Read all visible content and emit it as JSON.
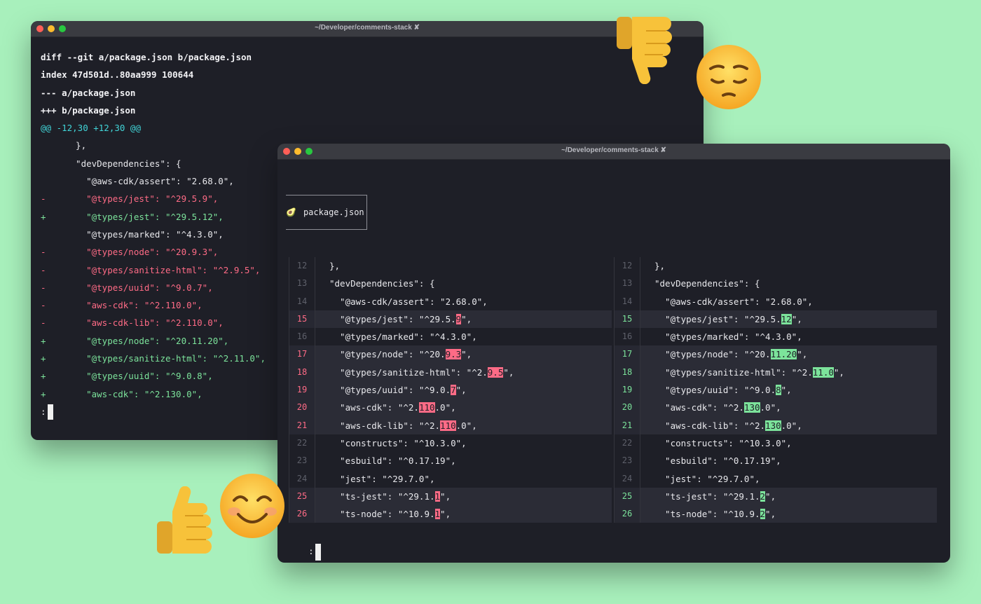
{
  "window_back": {
    "title": "~/Developer/comments-stack ✘",
    "lines": [
      {
        "type": "bold",
        "sign": "",
        "text": "diff --git a/package.json b/package.json"
      },
      {
        "type": "bold",
        "sign": "",
        "text": "index 47d501d..80aa999 100644"
      },
      {
        "type": "bold",
        "sign": "",
        "text": "--- a/package.json"
      },
      {
        "type": "bold",
        "sign": "",
        "text": "+++ b/package.json"
      },
      {
        "type": "hunk",
        "sign": "",
        "text": "@@ -12,30 +12,30 @@"
      },
      {
        "type": "ctx",
        "sign": " ",
        "text": "  },"
      },
      {
        "type": "ctx",
        "sign": " ",
        "text": "  \"devDependencies\": {"
      },
      {
        "type": "ctx",
        "sign": " ",
        "text": "    \"@aws-cdk/assert\": \"2.68.0\","
      },
      {
        "type": "del",
        "sign": "-",
        "text": "    \"@types/jest\": \"^29.5.9\","
      },
      {
        "type": "add",
        "sign": "+",
        "text": "    \"@types/jest\": \"^29.5.12\","
      },
      {
        "type": "ctx",
        "sign": " ",
        "text": "    \"@types/marked\": \"^4.3.0\","
      },
      {
        "type": "del",
        "sign": "-",
        "text": "    \"@types/node\": \"^20.9.3\","
      },
      {
        "type": "del",
        "sign": "-",
        "text": "    \"@types/sanitize-html\": \"^2.9.5\","
      },
      {
        "type": "del",
        "sign": "-",
        "text": "    \"@types/uuid\": \"^9.0.7\","
      },
      {
        "type": "del",
        "sign": "-",
        "text": "    \"aws-cdk\": \"^2.110.0\","
      },
      {
        "type": "del",
        "sign": "-",
        "text": "    \"aws-cdk-lib\": \"^2.110.0\","
      },
      {
        "type": "add",
        "sign": "+",
        "text": "    \"@types/node\": \"^20.11.20\","
      },
      {
        "type": "add",
        "sign": "+",
        "text": "    \"@types/sanitize-html\": \"^2.11.0\","
      },
      {
        "type": "add",
        "sign": "+",
        "text": "    \"@types/uuid\": \"^9.0.8\","
      },
      {
        "type": "add",
        "sign": "+",
        "text": "    \"aws-cdk\": \"^2.130.0\","
      }
    ],
    "prompt": ":"
  },
  "window_front": {
    "title": "~/Developer/comments-stack ✘",
    "file_name": "package.json",
    "prompt": ":",
    "left_rows": [
      {
        "ln": "12",
        "chg": false,
        "parts": [
          {
            "t": "},"
          }
        ]
      },
      {
        "ln": "13",
        "chg": false,
        "parts": [
          {
            "t": "\"devDependencies\": {"
          }
        ]
      },
      {
        "ln": "14",
        "chg": false,
        "parts": [
          {
            "t": "  \"@aws-cdk/assert\": \"2.68.0\","
          }
        ]
      },
      {
        "ln": "15",
        "chg": true,
        "parts": [
          {
            "t": "  \"@types/jest\": \"^29.5."
          },
          {
            "t": "9",
            "h": true
          },
          {
            "t": "\","
          }
        ]
      },
      {
        "ln": "16",
        "chg": false,
        "parts": [
          {
            "t": "  \"@types/marked\": \"^4.3.0\","
          }
        ]
      },
      {
        "ln": "17",
        "chg": true,
        "parts": [
          {
            "t": "  \"@types/node\": \"^20."
          },
          {
            "t": "9.3",
            "h": true
          },
          {
            "t": "\","
          }
        ]
      },
      {
        "ln": "18",
        "chg": true,
        "parts": [
          {
            "t": "  \"@types/sanitize-html\": \"^2."
          },
          {
            "t": "9.5",
            "h": true
          },
          {
            "t": "\","
          }
        ]
      },
      {
        "ln": "19",
        "chg": true,
        "parts": [
          {
            "t": "  \"@types/uuid\": \"^9.0."
          },
          {
            "t": "7",
            "h": true
          },
          {
            "t": "\","
          }
        ]
      },
      {
        "ln": "20",
        "chg": true,
        "parts": [
          {
            "t": "  \"aws-cdk\": \"^2."
          },
          {
            "t": "110",
            "h": true
          },
          {
            "t": ".0\","
          }
        ]
      },
      {
        "ln": "21",
        "chg": true,
        "parts": [
          {
            "t": "  \"aws-cdk-lib\": \"^2."
          },
          {
            "t": "110",
            "h": true
          },
          {
            "t": ".0\","
          }
        ]
      },
      {
        "ln": "22",
        "chg": false,
        "parts": [
          {
            "t": "  \"constructs\": \"^10.3.0\","
          }
        ]
      },
      {
        "ln": "23",
        "chg": false,
        "parts": [
          {
            "t": "  \"esbuild\": \"^0.17.19\","
          }
        ]
      },
      {
        "ln": "24",
        "chg": false,
        "parts": [
          {
            "t": "  \"jest\": \"^29.7.0\","
          }
        ]
      },
      {
        "ln": "25",
        "chg": true,
        "parts": [
          {
            "t": "  \"ts-jest\": \"^29.1."
          },
          {
            "t": "1",
            "h": true
          },
          {
            "t": "\","
          }
        ]
      },
      {
        "ln": "26",
        "chg": true,
        "parts": [
          {
            "t": "  \"ts-node\": \"^10.9."
          },
          {
            "t": "1",
            "h": true
          },
          {
            "t": "\","
          }
        ]
      }
    ],
    "right_rows": [
      {
        "ln": "12",
        "chg": false,
        "parts": [
          {
            "t": "},"
          }
        ]
      },
      {
        "ln": "13",
        "chg": false,
        "parts": [
          {
            "t": "\"devDependencies\": {"
          }
        ]
      },
      {
        "ln": "14",
        "chg": false,
        "parts": [
          {
            "t": "  \"@aws-cdk/assert\": \"2.68.0\","
          }
        ]
      },
      {
        "ln": "15",
        "chg": true,
        "parts": [
          {
            "t": "  \"@types/jest\": \"^29.5."
          },
          {
            "t": "12",
            "h": true
          },
          {
            "t": "\","
          }
        ]
      },
      {
        "ln": "16",
        "chg": false,
        "parts": [
          {
            "t": "  \"@types/marked\": \"^4.3.0\","
          }
        ]
      },
      {
        "ln": "17",
        "chg": true,
        "parts": [
          {
            "t": "  \"@types/node\": \"^20."
          },
          {
            "t": "11.20",
            "h": true
          },
          {
            "t": "\","
          }
        ]
      },
      {
        "ln": "18",
        "chg": true,
        "parts": [
          {
            "t": "  \"@types/sanitize-html\": \"^2."
          },
          {
            "t": "11.0",
            "h": true
          },
          {
            "t": "\","
          }
        ]
      },
      {
        "ln": "19",
        "chg": true,
        "parts": [
          {
            "t": "  \"@types/uuid\": \"^9.0."
          },
          {
            "t": "8",
            "h": true
          },
          {
            "t": "\","
          }
        ]
      },
      {
        "ln": "20",
        "chg": true,
        "parts": [
          {
            "t": "  \"aws-cdk\": \"^2."
          },
          {
            "t": "130",
            "h": true
          },
          {
            "t": ".0\","
          }
        ]
      },
      {
        "ln": "21",
        "chg": true,
        "parts": [
          {
            "t": "  \"aws-cdk-lib\": \"^2."
          },
          {
            "t": "130",
            "h": true
          },
          {
            "t": ".0\","
          }
        ]
      },
      {
        "ln": "22",
        "chg": false,
        "parts": [
          {
            "t": "  \"constructs\": \"^10.3.0\","
          }
        ]
      },
      {
        "ln": "23",
        "chg": false,
        "parts": [
          {
            "t": "  \"esbuild\": \"^0.17.19\","
          }
        ]
      },
      {
        "ln": "24",
        "chg": false,
        "parts": [
          {
            "t": "  \"jest\": \"^29.7.0\","
          }
        ]
      },
      {
        "ln": "25",
        "chg": true,
        "parts": [
          {
            "t": "  \"ts-jest\": \"^29.1."
          },
          {
            "t": "2",
            "h": true
          },
          {
            "t": "\","
          }
        ]
      },
      {
        "ln": "26",
        "chg": true,
        "parts": [
          {
            "t": "  \"ts-node\": \"^10.9."
          },
          {
            "t": "2",
            "h": true
          },
          {
            "t": "\","
          }
        ]
      }
    ]
  },
  "decorations": {
    "thumbs_down": "thumbs-down-icon",
    "pensive_face": "pensive-face-icon",
    "thumbs_up": "thumbs-up-icon",
    "smiling_face": "smiling-face-icon"
  },
  "colors": {
    "background": "#a8f0bc",
    "terminal": "#1e1f27",
    "deleted": "#ff6b86",
    "added": "#7ce39b",
    "hunk": "#41d5d8"
  }
}
